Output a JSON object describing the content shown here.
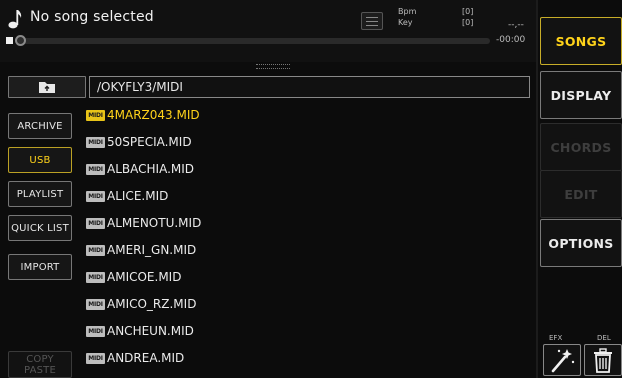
{
  "header": {
    "song_title": "No song selected",
    "bpm_label": "Bpm",
    "key_label": "Key",
    "bpm_value": "[0]",
    "key_value": "[0]",
    "time_top": "--,--",
    "time_value": "-00:00",
    "progress": 0
  },
  "path": {
    "current": "/OKYFLY3/MIDI"
  },
  "left_nav": {
    "archive": "ARCHIVE",
    "usb": "USB",
    "playlist": "PLAYLIST",
    "quick_list": "QUICK LIST",
    "import": "IMPORT",
    "copy_paste": "COPY PASTE"
  },
  "files": [
    {
      "badge": "MIDI",
      "name": "4MARZ043.MID",
      "selected": true
    },
    {
      "badge": "MIDI",
      "name": "50SPECIA.MID"
    },
    {
      "badge": "MIDI",
      "name": "ALBACHIA.MID"
    },
    {
      "badge": "MIDI",
      "name": "ALICE.MID"
    },
    {
      "badge": "MIDI",
      "name": "ALMENOTU.MID"
    },
    {
      "badge": "MIDI",
      "name": "AMERI_GN.MID"
    },
    {
      "badge": "MIDI",
      "name": "AMICOE.MID"
    },
    {
      "badge": "MIDI",
      "name": "AMICO_RZ.MID"
    },
    {
      "badge": "MIDI",
      "name": "ANCHEUN.MID"
    },
    {
      "badge": "MIDI",
      "name": "ANDREA.MID"
    }
  ],
  "right_panel": {
    "songs": "SONGS",
    "display": "DISPLAY",
    "chords": "CHORDS",
    "edit": "EDIT",
    "options": "OPTIONS",
    "efx_label": "EFX",
    "del_label": "DEL"
  },
  "colors": {
    "accent": "#ffd31a",
    "background": "#0c0c0c",
    "border": "#7a7a7a"
  }
}
